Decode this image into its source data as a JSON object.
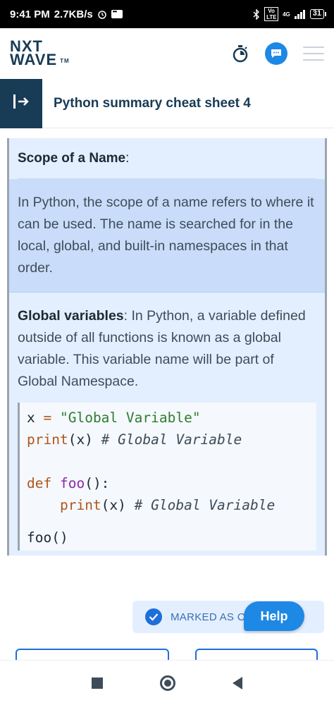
{
  "status_bar": {
    "time": "9:41 PM",
    "speed": "2.7KB/s",
    "network": "4G",
    "volte": "Vo LTE",
    "battery": "31"
  },
  "header": {
    "logo_line1": "NXT",
    "logo_line2": "WAVE",
    "logo_tm": "TM"
  },
  "title_bar": {
    "title": "Python summary cheat sheet 4"
  },
  "content": {
    "heading_bold": "Scope of a Name",
    "heading_suffix": ":",
    "scope_paragraph": "In Python, the scope of a name refers to where it can be used. The name is searched for in the local, global, and built-in namespaces in that order.",
    "global_bold": "Global variables",
    "global_paragraph": ": In Python, a variable defined outside of all functions is known as a global variable. This variable name will be part of Global Namespace.",
    "code": {
      "line1_var": "x",
      "line1_eq": " = ",
      "line1_str": "\"Global Variable\"",
      "line2_fn": "print",
      "line2_args": "(x) ",
      "line2_comment": "# Global Variable",
      "line4_kw": "def",
      "line4_name": " foo",
      "line4_rest": "():",
      "line5_indent": "    ",
      "line5_fn": "print",
      "line5_args": "(x) ",
      "line5_comment": "# Global Variable",
      "line7_partial": "foo()"
    }
  },
  "actions": {
    "marked_label": "MARKED AS C",
    "help_label": "Help"
  },
  "colors": {
    "brand_dark": "#183b56",
    "accent_blue": "#1e88e5",
    "content_bg": "#e3efff",
    "highlight_bg": "#c9ddfa"
  }
}
